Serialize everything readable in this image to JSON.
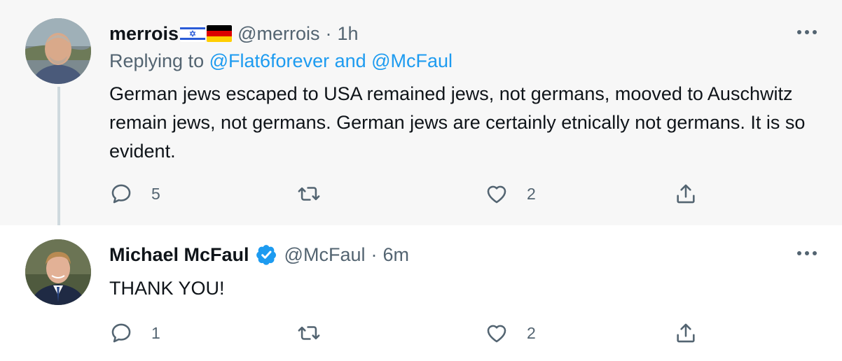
{
  "tweets": [
    {
      "display_name": "merrois",
      "flags": [
        "israel-flag",
        "germany-flag"
      ],
      "handle": "@merrois",
      "separator": "·",
      "time": "1h",
      "replying_prefix": "Replying to",
      "replying_mentions": "@Flat6forever and @McFaul",
      "text": "German jews escaped to USA remained jews, not germans, mooved to Auschwitz remain jews, not germans. German jews are certainly etnically not germans. It is so evident.",
      "replies": "5",
      "likes": "2"
    },
    {
      "display_name": "Michael McFaul",
      "verified": true,
      "handle": "@McFaul",
      "separator": "·",
      "time": "6m",
      "text": "THANK YOU!",
      "replies": "1",
      "likes": "2"
    }
  ],
  "colors": {
    "accent": "#1d9bf0",
    "muted": "#536471",
    "text": "#0f1419",
    "highlight_bg": "#f7f7f7"
  }
}
